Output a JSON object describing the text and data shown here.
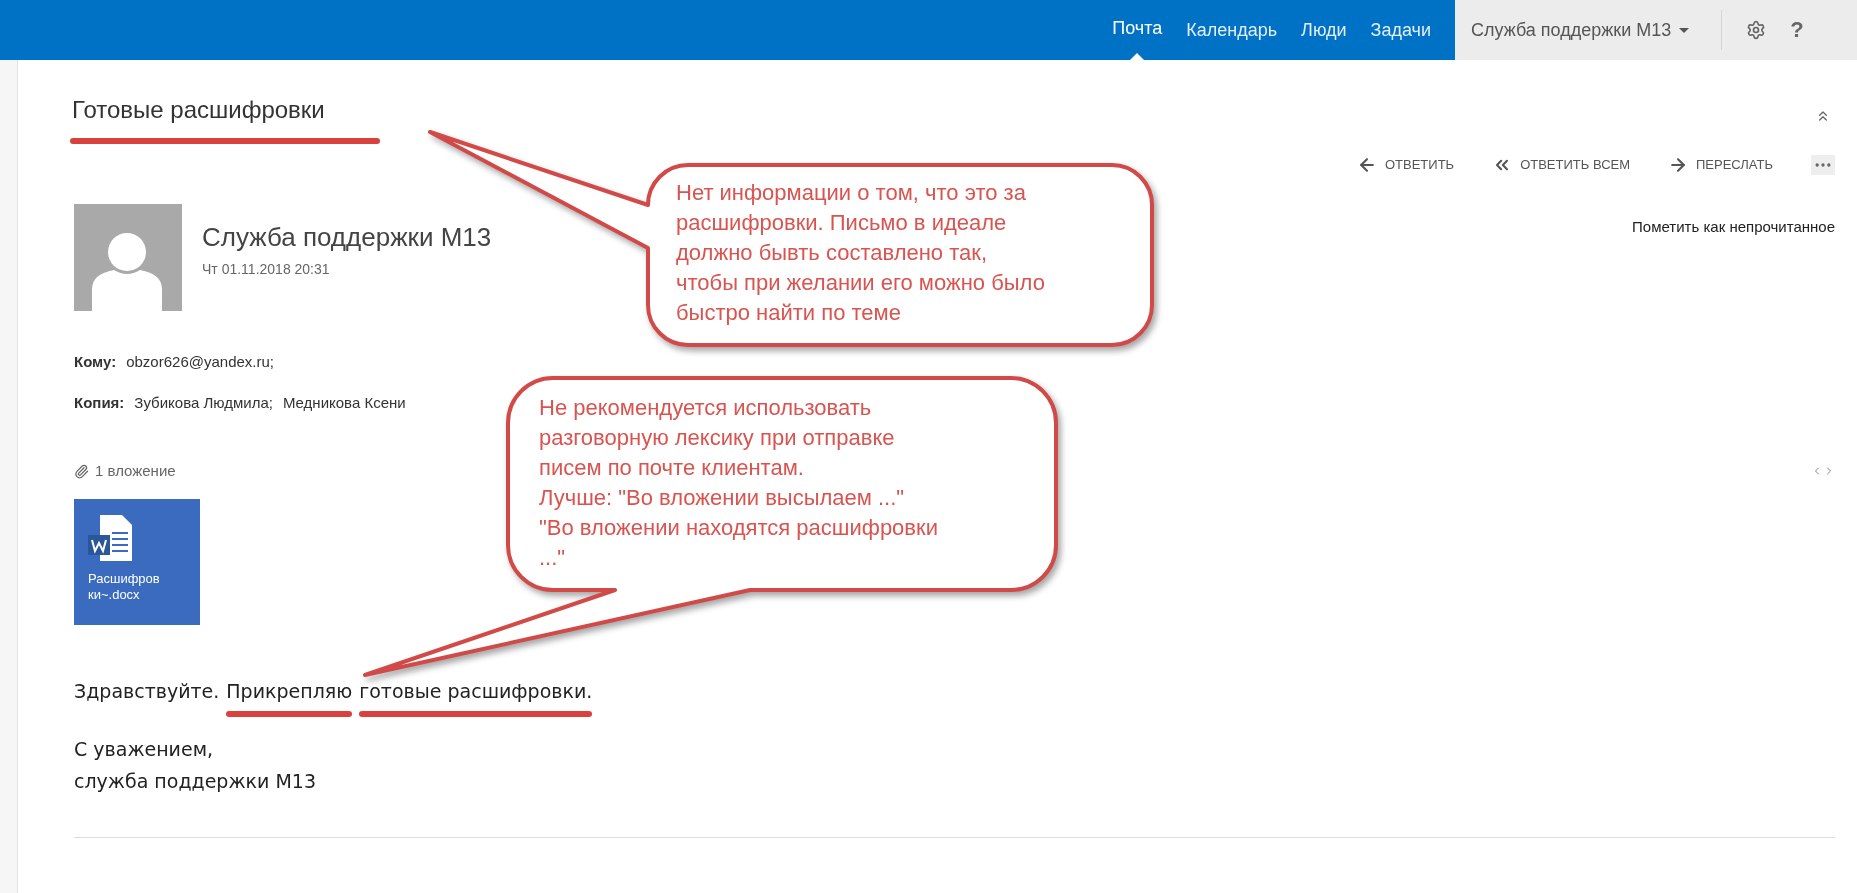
{
  "top_bar": {
    "nav": [
      {
        "label": "Почта",
        "selected": true
      },
      {
        "label": "Календарь",
        "selected": false
      },
      {
        "label": "Люди",
        "selected": false
      },
      {
        "label": "Задачи",
        "selected": false
      }
    ],
    "account": "Служба поддержки М13",
    "help": "?"
  },
  "message": {
    "subject": {
      "text": "Готовые расшифровки",
      "underlined": true
    },
    "actions": [
      {
        "label": "ОТВЕТИТЬ",
        "kind": "reply"
      },
      {
        "label": "ОТВЕТИТЬ ВСЕМ",
        "kind": "reply_all"
      },
      {
        "label": "ПЕРЕСЛАТЬ",
        "kind": "forward"
      }
    ],
    "mark_unread": "Пометить как непрочитанное",
    "sender": "Служба поддержки М13",
    "date": "Чт 01.11.2018 20:31",
    "to": {
      "label": "Кому:",
      "recipients": [
        "obzor626@yandex.ru;"
      ]
    },
    "cc": {
      "label": "Копия:",
      "recipients": [
        "Зубикова Людмила;",
        "Медникова Ксени"
      ]
    },
    "attachments_count": "1 вложение",
    "attachments": [
      {
        "name": "Расшифровки~.docx"
      }
    ],
    "greeting": [
      {
        "text": "Здравствуйте.",
        "underlined": false
      },
      {
        "text": "Прикрепляю",
        "underlined": true
      },
      {
        "text": "готовые расшифровки.",
        "underlined": true
      }
    ],
    "closing": [
      "С уважением,",
      "служба поддержки М13"
    ]
  },
  "callouts": [
    {
      "text": "Нет информации о том, что это за\nрасшифровки. Письмо в идеале\nдолжно бывть составлено так,\nчтобы при желании его можно было\nбыстро найти по теме"
    },
    {
      "text": "Не рекомендуется использовать\nразговорную лексику при отправке\nписем по почте клиентам.\nЛучше: \"Во вложении высылаем ...\"\n\"Во вложении находятся расшифровки\n...\""
    }
  ]
}
